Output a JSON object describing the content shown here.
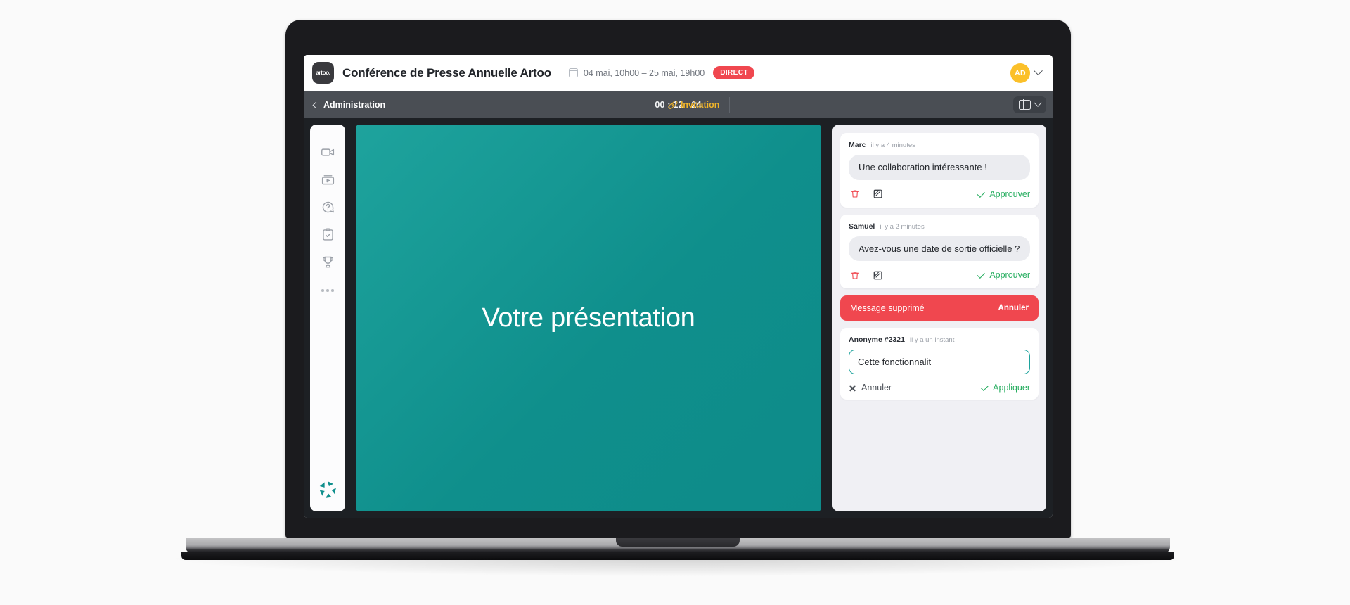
{
  "header": {
    "logo_text": "artoo.",
    "logo_icon": "artoo-logo-icon",
    "title": "Conférence de Presse Annuelle Artoo",
    "calendar_icon": "calendar-icon",
    "date_range": "04 mai, 10h00  –  25 mai, 19h00",
    "live_badge": "DIRECT",
    "avatar_initials": "AD",
    "avatar_color": "#fbc02a",
    "avatar_chevron_icon": "chevron-down-icon"
  },
  "toolbar": {
    "back_icon": "chevron-left-icon",
    "back_label": "Administration",
    "timer": "00 : 12 : 24",
    "invitation_icon": "link-icon",
    "invitation_label": "Invitation",
    "layout_icon": "split-panel-icon",
    "layout_chevron_icon": "chevron-down-icon"
  },
  "sidebar": {
    "items": [
      {
        "name": "video-camera-icon",
        "label": "Vidéo"
      },
      {
        "name": "media-play-icon",
        "label": "Média"
      },
      {
        "name": "question-bubble-icon",
        "label": "Questions"
      },
      {
        "name": "clipboard-check-icon",
        "label": "Sondage"
      },
      {
        "name": "trophy-icon",
        "label": "Classement"
      }
    ],
    "more_icon": "more-dots-icon",
    "brand_icon": "shutter-logo-icon"
  },
  "stage": {
    "title": "Votre présentation",
    "background_color": "#0f8f8c"
  },
  "comments": {
    "accent_approve": "#27ae60",
    "accent_delete": "#f0474f",
    "accent_edit_border": "#1ea39d",
    "cards": [
      {
        "author": "Marc",
        "time": "il y a 4 minutes",
        "message": "Une collaboration intéressante !",
        "delete_icon": "trash-icon",
        "edit_icon": "pencil-square-icon",
        "approve_icon": "check-icon",
        "approve_label": "Approuver"
      },
      {
        "author": "Samuel",
        "time": "il y a 2 minutes",
        "message": "Avez-vous une date de sortie officielle ?",
        "delete_icon": "trash-icon",
        "edit_icon": "pencil-square-icon",
        "approve_icon": "check-icon",
        "approve_label": "Approuver"
      }
    ],
    "deleted_banner": {
      "text": "Message supprimé",
      "undo_label": "Annuler"
    },
    "edit_card": {
      "author": "Anonyme #2321",
      "time": "il y a un instant",
      "input_value": "Cette fonctionnalit",
      "cancel_icon": "close-icon",
      "cancel_label": "Annuler",
      "apply_icon": "check-icon",
      "apply_label": "Appliquer"
    }
  }
}
